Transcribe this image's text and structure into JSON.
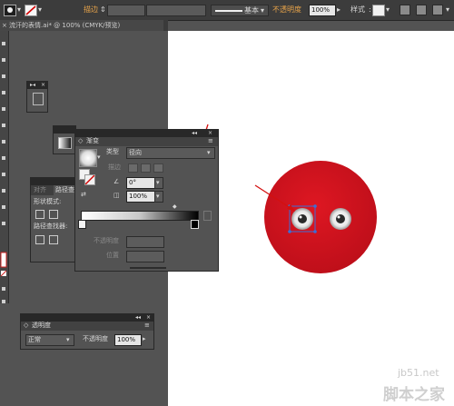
{
  "control_bar": {
    "stroke_label": "描边",
    "brush_label": "基本",
    "opacity_label": "不透明度",
    "opacity_value": "100%",
    "style_label": "样式"
  },
  "document_tab": {
    "title": "流汗的表情.ai* @ 100% (CMYK/预览)"
  },
  "panels": {
    "align_pathfinder": {
      "tab_align": "对齐",
      "tab_pathfinder": "路径查",
      "shape_modes_label": "形状模式:",
      "pathfinder_label": "路径查找器:"
    },
    "gradient": {
      "tab_label": "渐变",
      "type_label": "类型",
      "type_value": "径向",
      "stroke_label": "描边",
      "angle_value": "0°",
      "aspect_value": "100%",
      "opacity_label": "不透明度",
      "location_label": "位置"
    },
    "transparency": {
      "tab_label": "透明度",
      "blend_mode": "正常",
      "opacity_label": "不透明度",
      "opacity_value": "100%"
    }
  },
  "watermark": {
    "url": "jb51.net",
    "name": "脚本之家"
  },
  "colors": {
    "red_face": "#d0121d",
    "arrow": "#d41010",
    "ui_dark": "#3c3c3c",
    "panel_bg": "#535353",
    "accent_orange": "#e8a44a"
  }
}
